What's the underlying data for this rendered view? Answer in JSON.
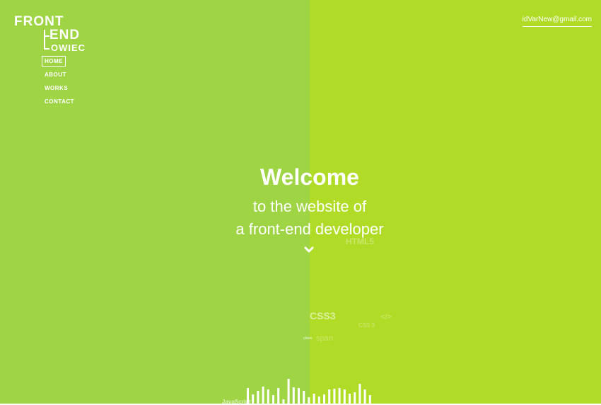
{
  "logo": {
    "line1": "FRONT",
    "line2": "END",
    "line3": "OWIEC"
  },
  "nav": {
    "items": [
      "HOME",
      "ABOUT",
      "WORKS",
      "CONTACT"
    ],
    "active": "HOME"
  },
  "email": "idVarNew@gmail.com",
  "hero": {
    "title": "Welcome",
    "subtitle_line1": "to the website of",
    "subtitle_line2": "a front-end developer",
    "scroll_icon": "chevron-down-icon"
  },
  "decor": {
    "html5": "HTML5",
    "css3": "CSS3",
    "code_tag": "</>",
    "css_small": "CSS 3",
    "class_text": "class",
    "span_text": "span",
    "javascript": "JavaScript"
  },
  "colors": {
    "left_panel": "#9fd545",
    "right_panel": "#b0dc27",
    "text": "#ffffff"
  },
  "bars": [
    22,
    13,
    18,
    24,
    20,
    12,
    22,
    6,
    35,
    23,
    22,
    18,
    9,
    14,
    10,
    13,
    20,
    21,
    22,
    20,
    14,
    16,
    28,
    20,
    12
  ]
}
